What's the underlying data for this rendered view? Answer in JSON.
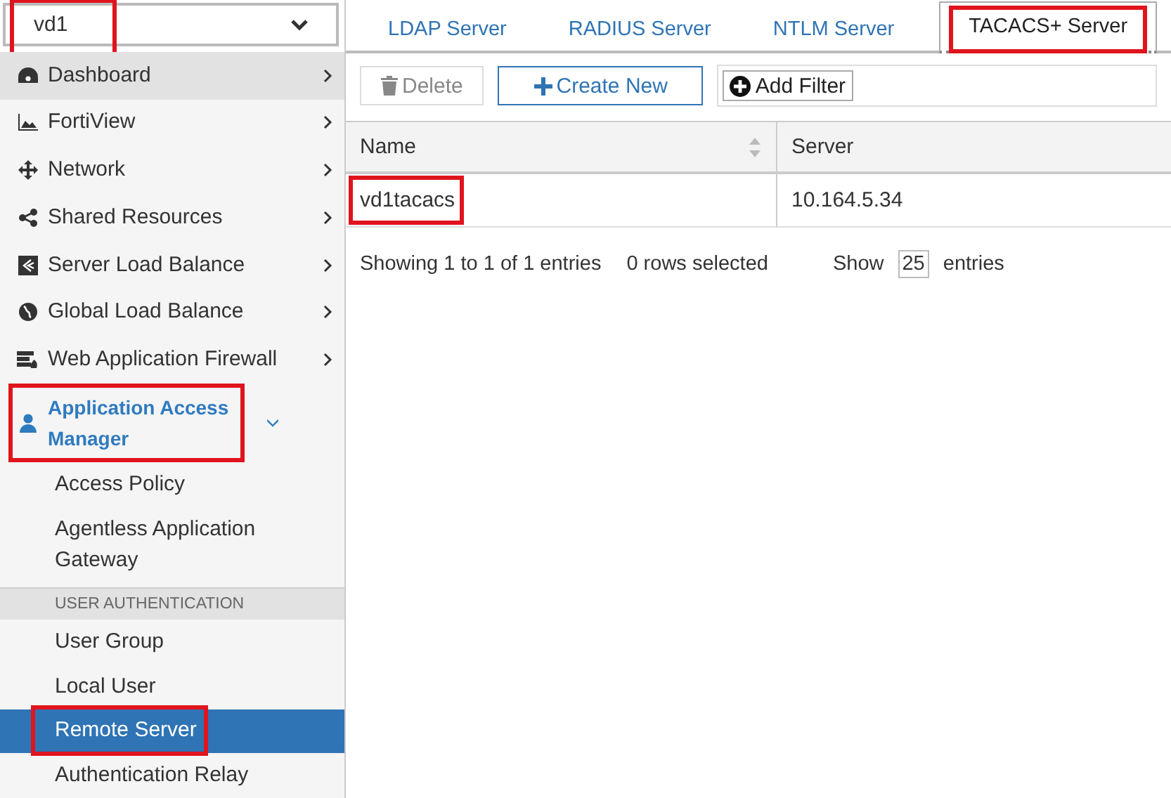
{
  "vdom_select": {
    "value": "vd1",
    "annotated": true
  },
  "sidebar": {
    "items": [
      {
        "kind": "menu",
        "label": "Dashboard",
        "selected": true,
        "expanded": false,
        "annotated": false
      },
      {
        "kind": "menu",
        "label": "FortiView",
        "selected": false,
        "expanded": false,
        "annotated": false
      },
      {
        "kind": "menu",
        "label": "Network",
        "selected": false,
        "expanded": false,
        "annotated": false
      },
      {
        "kind": "menu",
        "label": "Shared Resources",
        "selected": false,
        "expanded": false,
        "annotated": false
      },
      {
        "kind": "menu",
        "label": "Server Load Balance",
        "selected": false,
        "expanded": false,
        "annotated": false
      },
      {
        "kind": "menu",
        "label": "Global Load Balance",
        "selected": false,
        "expanded": false,
        "annotated": false
      },
      {
        "kind": "menu",
        "label": "Web Application Firewall",
        "selected": false,
        "expanded": false,
        "annotated": false
      },
      {
        "kind": "menu",
        "label": "Application Access Manager",
        "selected": false,
        "expanded": true,
        "annotated": true
      },
      {
        "kind": "sub",
        "label": "Access Policy",
        "selected": false,
        "annotated": false
      },
      {
        "kind": "sub",
        "label": "Agentless Application Gateway",
        "selected": false,
        "annotated": false
      },
      {
        "kind": "header",
        "label": "USER AUTHENTICATION"
      },
      {
        "kind": "sub",
        "label": "User Group",
        "selected": false,
        "annotated": false
      },
      {
        "kind": "sub",
        "label": "Local User",
        "selected": false,
        "annotated": false
      },
      {
        "kind": "sub",
        "label": "Remote Server",
        "selected": true,
        "annotated": true
      },
      {
        "kind": "sub",
        "label": "Authentication Relay",
        "selected": false,
        "annotated": false
      }
    ]
  },
  "tabs": [
    {
      "label": "LDAP Server",
      "selected": false,
      "annotated": false
    },
    {
      "label": "RADIUS Server",
      "selected": false,
      "annotated": false
    },
    {
      "label": "NTLM Server",
      "selected": false,
      "annotated": false
    },
    {
      "label": "TACACS+ Server",
      "selected": true,
      "annotated": true
    }
  ],
  "toolbar": [
    {
      "kind": "delete",
      "label": "Delete",
      "disabled": true
    },
    {
      "kind": "create",
      "label": "Create New",
      "disabled": false
    },
    {
      "kind": "filter",
      "label": "Add Filter"
    }
  ],
  "table": {
    "columns": [
      {
        "label": "Name",
        "sortable": true
      },
      {
        "label": "Server",
        "sortable": false
      }
    ],
    "rows": [
      {
        "cells": [
          "vd1tacacs",
          "10.164.5.34"
        ],
        "annotated": true
      }
    ]
  },
  "footer": {
    "showing": "Showing 1 to 1 of 1 entries",
    "selected": "0 rows selected",
    "show": "Show",
    "page_size": "25",
    "entries": "entries"
  }
}
